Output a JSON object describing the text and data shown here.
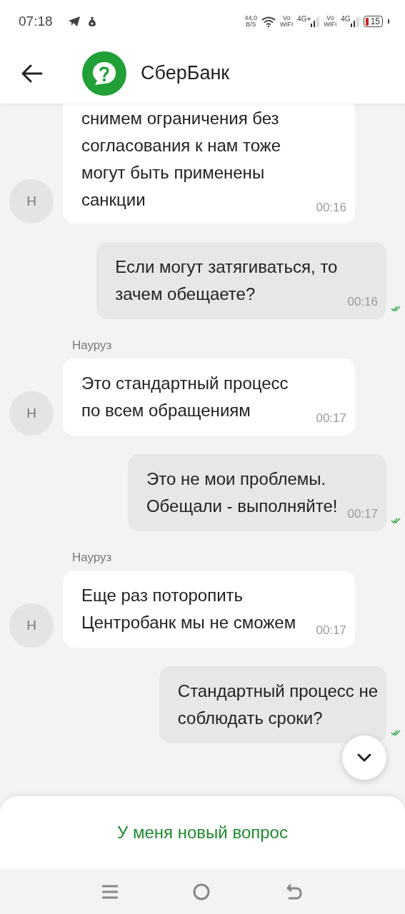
{
  "status_bar": {
    "time": "07:18",
    "speed": {
      "value": "44,0",
      "unit": "B/S"
    },
    "sims": [
      {
        "call_top": "Vo",
        "call_bottom": "WiFi",
        "network": "4G+"
      },
      {
        "call_top": "Vo",
        "call_bottom": "WiFi",
        "network": "4G"
      }
    ],
    "battery": "15"
  },
  "header": {
    "title": "СберБанк"
  },
  "messages": [
    {
      "kind": "incoming",
      "text": "снимем ограничения без\nсогласования к нам тоже\nмогут быть применены\nсанкции",
      "time": "00:16",
      "avatar": "Н"
    },
    {
      "kind": "outgoing",
      "text": "Если могут затягиваться, то\nзачем обещаете?",
      "time": "00:16",
      "read": true
    },
    {
      "kind": "incoming",
      "sender": "Науруз",
      "text": "Это стандартный процесс\nпо всем обращениям",
      "time": "00:17",
      "avatar": "Н"
    },
    {
      "kind": "outgoing",
      "text": "Это не мои проблемы.\nОбещали - выполняйте!",
      "time": "00:17",
      "read": true
    },
    {
      "kind": "incoming",
      "sender": "Науруз",
      "text": "Еще раз поторопить\nЦентробанк мы не сможем",
      "time": "00:17",
      "avatar": "Н"
    },
    {
      "kind": "outgoing",
      "text": "Стандартный процесс не\nсоблюдать сроки?",
      "read": true
    }
  ],
  "action_button": "У меня новый вопрос"
}
